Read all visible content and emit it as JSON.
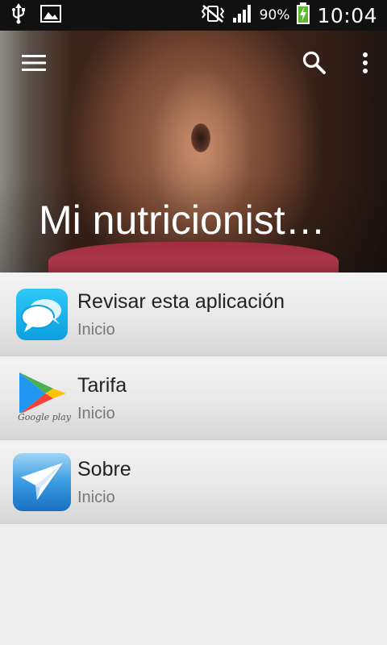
{
  "status_bar": {
    "battery_percent": "90%",
    "time": "10:04"
  },
  "hero": {
    "title": "Mi nutricionist…",
    "menu_icon": "hamburger-icon",
    "search_icon": "search-icon",
    "overflow_icon": "more-vertical-icon"
  },
  "items": [
    {
      "title": "Revisar esta aplicación",
      "subtitle": "Inicio",
      "icon": "chat-bubbles-icon"
    },
    {
      "title": "Tarifa",
      "subtitle": "Inicio",
      "icon": "google-play-icon",
      "icon_caption": "Google play"
    },
    {
      "title": "Sobre",
      "subtitle": "Inicio",
      "icon": "paper-plane-icon"
    }
  ]
}
